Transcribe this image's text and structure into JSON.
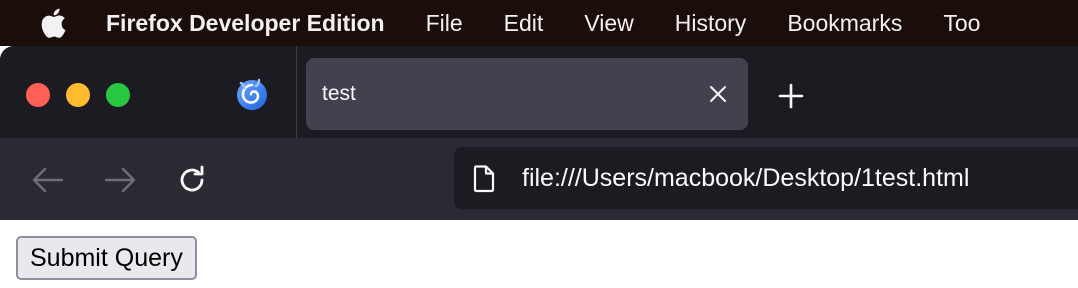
{
  "menubar": {
    "apple_icon": "apple-logo-icon",
    "app_name": "Firefox Developer Edition",
    "items": [
      "File",
      "Edit",
      "View",
      "History",
      "Bookmarks",
      "Too"
    ]
  },
  "tabs": [
    {
      "title": "test",
      "active": true
    }
  ],
  "toolbar": {
    "back_icon": "arrow-left-icon",
    "forward_icon": "arrow-right-icon",
    "reload_icon": "reload-icon",
    "new_tab_icon": "plus-icon",
    "close_tab_icon": "close-icon"
  },
  "urlbar": {
    "page_icon": "document-icon",
    "url": "file:///Users/macbook/Desktop/1test.html"
  },
  "page": {
    "submit_label": "Submit Query"
  },
  "colors": {
    "menubar_bg": "#1b0d0a",
    "tabstrip_bg": "#1c1b22",
    "tab_active_bg": "#42414d",
    "navbar_bg": "#2b2a33",
    "urlbar_bg": "#1c1b22",
    "traffic_close": "#ff5f57",
    "traffic_min": "#febc2e",
    "traffic_max": "#28c840"
  }
}
